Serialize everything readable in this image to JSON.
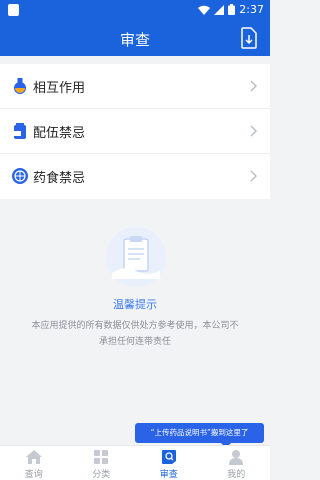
{
  "status_bar": {
    "time": "2:37"
  },
  "header": {
    "title": "审查"
  },
  "menu": [
    {
      "label": "相互作用",
      "icon": "flask-icon"
    },
    {
      "label": "配伍禁忌",
      "icon": "bottle-icon"
    },
    {
      "label": "药食禁忌",
      "icon": "food-icon"
    }
  ],
  "notice": {
    "title": "温馨提示",
    "description": "本应用提供的所有数据仅供处方参考使用，本公司不承担任何连带责任"
  },
  "tooltip": {
    "text": "“上传药品说明书”搬到这里了"
  },
  "tabs": [
    {
      "label": "查询",
      "icon": "home-icon",
      "active": false
    },
    {
      "label": "分类",
      "icon": "grid-icon",
      "active": false
    },
    {
      "label": "审查",
      "icon": "review-icon",
      "active": true
    },
    {
      "label": "我的",
      "icon": "user-icon",
      "active": false
    }
  ],
  "colors": {
    "primary": "#1b63dc",
    "accent": "#3d7cf0",
    "background": "#f2f3f5"
  }
}
